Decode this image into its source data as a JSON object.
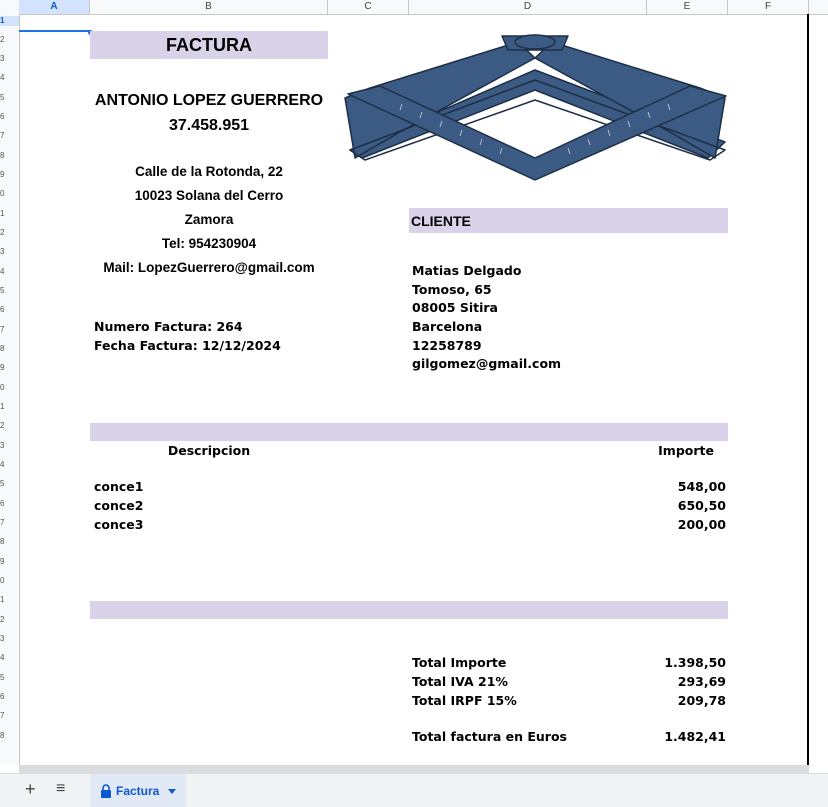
{
  "columns": [
    "A",
    "B",
    "C",
    "D",
    "E",
    "F"
  ],
  "rows": [
    "1",
    "2",
    "3",
    "4",
    "5",
    "6",
    "7",
    "8",
    "9",
    "0",
    "1",
    "2",
    "3",
    "4",
    "5",
    "6",
    "7",
    "8",
    "9",
    "0",
    "1",
    "2",
    "3",
    "4",
    "5",
    "6",
    "7",
    "8",
    "9",
    "0",
    "1",
    "2",
    "3",
    "4",
    "5",
    "6",
    "7",
    "8"
  ],
  "invoice": {
    "title": "FACTURA",
    "issuer": {
      "name": "ANTONIO LOPEZ GUERRERO",
      "id": "37.458.951",
      "address": "Calle de la Rotonda, 22",
      "city": "10023 Solana del Cerro",
      "province": "Zamora",
      "phone": "Tel: 954230904",
      "email": "Mail: LopezGuerrero@gmail.com"
    },
    "number_line": "Numero Factura: 264",
    "date_line": "Fecha Factura: 12/12/2024",
    "client": {
      "header": "CLIENTE",
      "name": "Matias Delgado",
      "street": "Tomoso, 65",
      "city": "08005 Sitira",
      "province": "Barcelona",
      "id": "12258789",
      "email": "gilgomez@gmail.com"
    },
    "table": {
      "desc_header": "Descripcion",
      "amount_header": "Importe",
      "items": [
        {
          "desc": "conce1",
          "amount": "548,00"
        },
        {
          "desc": "conce2",
          "amount": "650,50"
        },
        {
          "desc": "conce3",
          "amount": "200,00"
        }
      ]
    },
    "totals": {
      "importe_label": "Total Importe",
      "importe": "1.398,50",
      "iva_label": "Total IVA 21%",
      "iva": "293,69",
      "irpf_label": "Total IRPF 15%",
      "irpf": "209,78",
      "total_label": "Total factura en Euros",
      "total": "1.482,41"
    }
  },
  "sheet_tab": {
    "label": "Factura"
  },
  "icons": {
    "add": "plus-icon",
    "menu": "hamburger-icon",
    "lock": "lock-icon",
    "dropdown": "caret-down-icon"
  },
  "colors": {
    "band": "#d9d2e9",
    "logo": "#3b5b84",
    "accent": "#0b57d0"
  }
}
